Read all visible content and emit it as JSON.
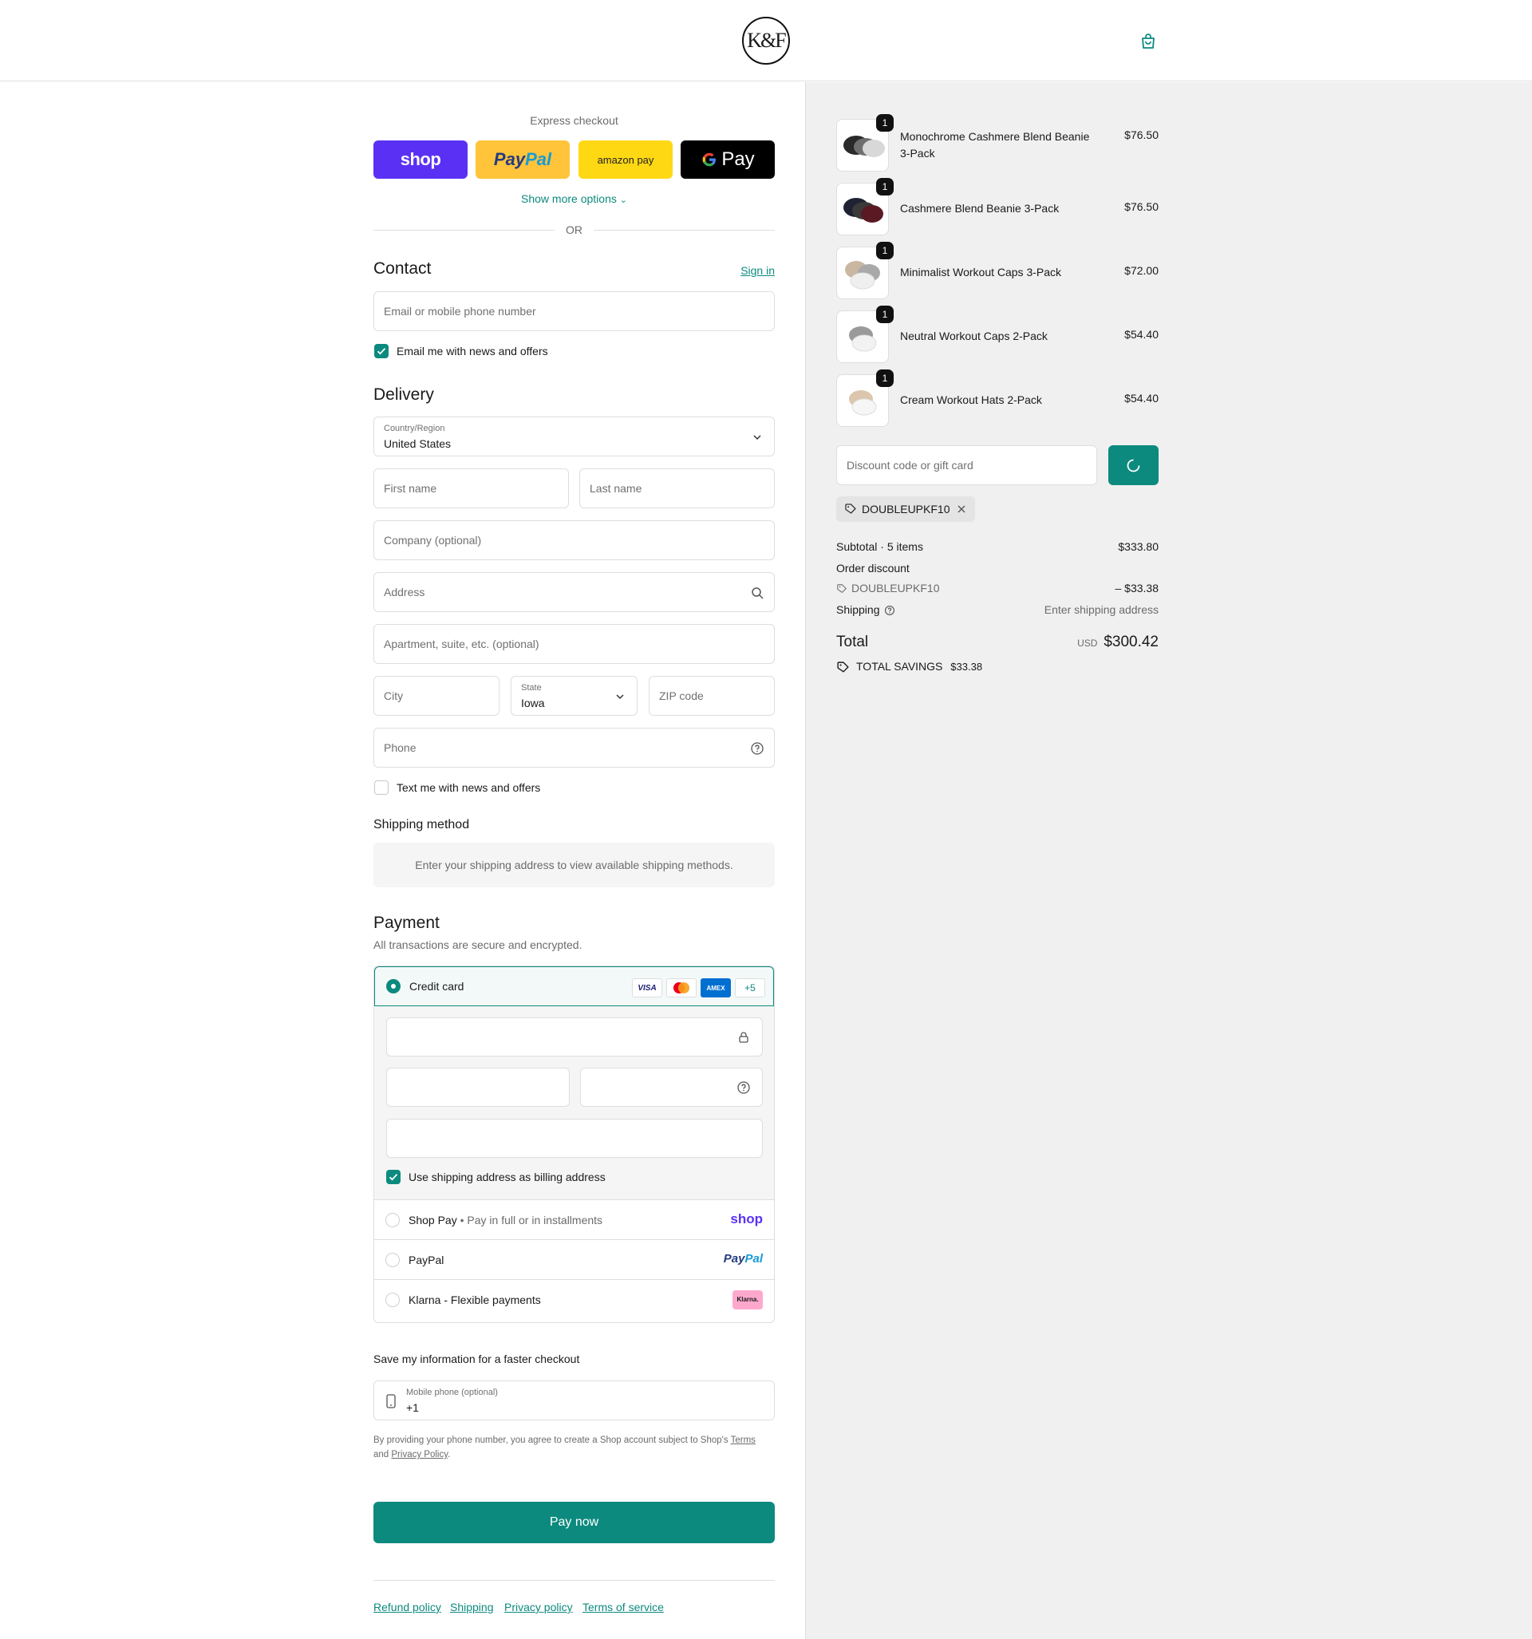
{
  "header": {
    "logo_text": "K&F",
    "cart_icon": "shopping-bag-icon"
  },
  "express": {
    "title": "Express checkout",
    "shop_label": "shop",
    "paypal_part1": "Pay",
    "paypal_part2": "Pal",
    "amazon_label": "amazon pay",
    "gpay_label": "Pay",
    "show_more": "Show more options",
    "or": "OR"
  },
  "contact": {
    "heading": "Contact",
    "sign_in": "Sign in",
    "email_placeholder": "Email or mobile phone number",
    "news_label": "Email me with news and offers",
    "news_checked": true
  },
  "delivery": {
    "heading": "Delivery",
    "country_label": "Country/Region",
    "country_value": "United States",
    "first_name": "First name",
    "last_name": "Last name",
    "company": "Company (optional)",
    "address": "Address",
    "apartment": "Apartment, suite, etc. (optional)",
    "city": "City",
    "state_label": "State",
    "state_value": "Iowa",
    "zip": "ZIP code",
    "phone": "Phone",
    "text_label": "Text me with news and offers",
    "text_checked": false
  },
  "shipping_method": {
    "heading": "Shipping method",
    "note": "Enter your shipping address to view available shipping methods."
  },
  "payment": {
    "heading": "Payment",
    "subtitle": "All transactions are secure and encrypted.",
    "credit_card": "Credit card",
    "cards": [
      "VISA",
      "MC",
      "AMEX",
      "+5"
    ],
    "billing_label": "Use shipping address as billing address",
    "shop_pay": "Shop Pay",
    "shop_pay_sub": "Pay in full or in installments",
    "shop_pay_logo": "shop",
    "paypal": "PayPal",
    "paypal_logo_1": "Pay",
    "paypal_logo_2": "Pal",
    "klarna": "Klarna - Flexible payments",
    "klarna_logo": "Klarna."
  },
  "save_info": {
    "heading": "Save my information for a faster checkout",
    "mobile_label": "Mobile phone (optional)",
    "mobile_value": "+1",
    "legal_1": "By providing your phone number, you agree to create a Shop account subject to Shop's ",
    "terms": "Terms",
    "legal_2": "and ",
    "privacy": "Privacy Policy",
    "legal_3": "."
  },
  "pay_now": "Pay now",
  "footer": [
    "Refund policy",
    "Shipping",
    "Privacy policy",
    "Terms of service"
  ],
  "cart": {
    "items": [
      {
        "name": "Monochrome Cashmere Blend Beanie 3-Pack",
        "price": "$76.50",
        "qty": "1"
      },
      {
        "name": "Cashmere Blend Beanie 3-Pack",
        "price": "$76.50",
        "qty": "1"
      },
      {
        "name": "Minimalist Workout Caps 3-Pack",
        "price": "$72.00",
        "qty": "1"
      },
      {
        "name": "Neutral Workout Caps 2-Pack",
        "price": "$54.40",
        "qty": "1"
      },
      {
        "name": "Cream Workout Hats 2-Pack",
        "price": "$54.40",
        "qty": "1"
      }
    ],
    "discount_placeholder": "Discount code or gift card",
    "applied_code": "DOUBLEUPKF10",
    "subtotal_label": "Subtotal · 5 items",
    "subtotal_value": "$333.80",
    "order_discount_label": "Order discount",
    "discount_code": "DOUBLEUPKF10",
    "discount_value": "– $33.38",
    "shipping_label": "Shipping",
    "shipping_value": "Enter shipping address",
    "total_label": "Total",
    "currency": "USD",
    "total_value": "$300.42",
    "savings_label": "TOTAL SAVINGS",
    "savings_value": "$33.38"
  },
  "colors": {
    "accent": "#0c8a7e",
    "shop_purple": "#5a31f4",
    "paypal_yellow": "#ffc439",
    "amazon_yellow": "#ffd814",
    "right_bg": "#f0f0f0"
  }
}
